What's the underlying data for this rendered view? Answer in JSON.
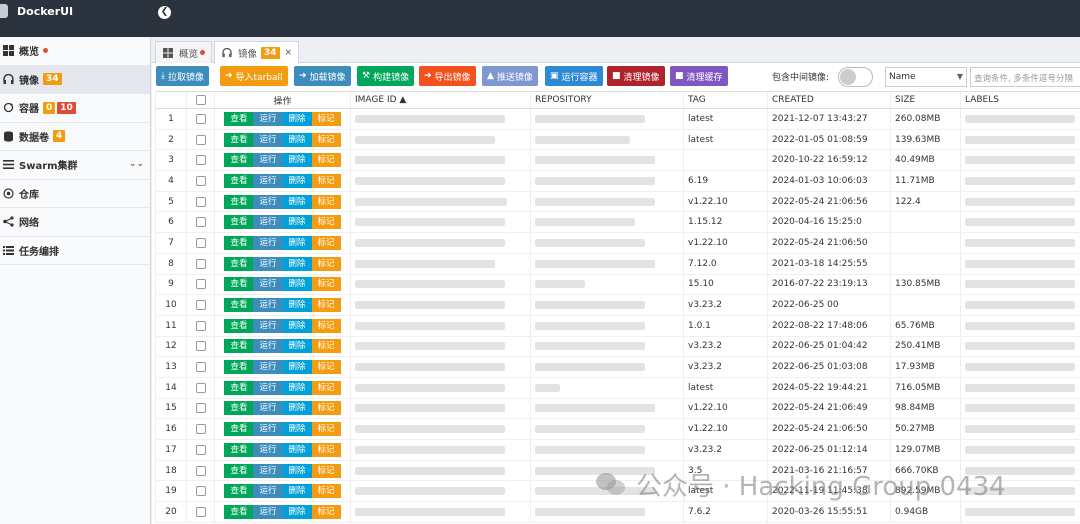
{
  "app": {
    "title": "DockerUI"
  },
  "sidebar": {
    "items": [
      {
        "label": "概览",
        "icon": "windows-icon",
        "dot": true
      },
      {
        "label": "镜像",
        "icon": "headset-icon",
        "badge": "34",
        "active": true
      },
      {
        "label": "容器",
        "icon": "refresh-icon",
        "badges": [
          "0",
          "10"
        ]
      },
      {
        "label": "数据卷",
        "icon": "database-icon",
        "badge": "4"
      },
      {
        "label": "Swarm集群",
        "icon": "swarm-icon",
        "chevron": true
      },
      {
        "label": "仓库",
        "icon": "radar-icon"
      },
      {
        "label": "网络",
        "icon": "network-icon"
      },
      {
        "label": "任务编排",
        "icon": "tasks-icon"
      }
    ]
  },
  "tabs": [
    {
      "label": "概览",
      "dot": true
    },
    {
      "label": "镜像",
      "badge": "34",
      "close": "×",
      "active": true
    }
  ],
  "toolbar": {
    "buttons": [
      {
        "label": "拉取镜像",
        "icon": "download-icon",
        "color": "#3c8dbc"
      },
      {
        "label": "导入tarball",
        "icon": "import-icon",
        "color": "#f39c12"
      },
      {
        "label": "加载镜像",
        "icon": "load-icon",
        "color": "#3c8dbc"
      },
      {
        "label": "构建镜像",
        "icon": "build-icon",
        "color": "#00a65a"
      },
      {
        "label": "导出镜像",
        "icon": "export-icon",
        "color": "#f4511e"
      },
      {
        "label": "推送镜像",
        "icon": "upload-icon",
        "color": "#7d97d0"
      },
      {
        "label": "运行容器",
        "icon": "run-icon",
        "color": "#2f8ad6"
      },
      {
        "label": "清理镜像",
        "icon": "trash-icon",
        "color": "#b0232d"
      },
      {
        "label": "清理缓存",
        "icon": "trash-icon",
        "color": "#7e57c2"
      }
    ],
    "include_intermediate_label": "包含中间镜像:",
    "filter_select": {
      "value": "Name"
    },
    "search": {
      "placeholder": "查询条件, 多条件逗号分隔"
    }
  },
  "table": {
    "headers": {
      "ops": "操作",
      "image_id": "IMAGE ID ▲",
      "repository": "REPOSITORY",
      "tag": "TAG",
      "created": "CREATED",
      "size": "SIZE",
      "labels": "LABELS"
    },
    "op_labels": {
      "view": "查看",
      "run": "运行",
      "delete": "删除",
      "mark": "标记"
    },
    "rows": [
      {
        "idx": "1",
        "tag": "latest",
        "created": "2021-12-07 13:43:27",
        "size": "260.08MB"
      },
      {
        "idx": "2",
        "tag": "latest",
        "created": "2022-01-05 01:08:59",
        "size": "139.63MB"
      },
      {
        "idx": "3",
        "tag": "",
        "created": "2020-10-22 16:59:12",
        "size": "40.49MB"
      },
      {
        "idx": "4",
        "tag": "6.19",
        "created": "2024-01-03 10:06:03",
        "size": "11.71MB"
      },
      {
        "idx": "5",
        "tag": "v1.22.10",
        "created": "2022-05-24 21:06:56",
        "size": "122.4"
      },
      {
        "idx": "6",
        "tag": "1.15.12",
        "created": "2020-04-16 15:25:0",
        "size": ""
      },
      {
        "idx": "7",
        "tag": "v1.22.10",
        "created": "2022-05-24 21:06:50",
        "size": ""
      },
      {
        "idx": "8",
        "tag": "7.12.0",
        "created": "2021-03-18 14:25:55",
        "size": ""
      },
      {
        "idx": "9",
        "tag": "15.10",
        "created": "2016-07-22 23:19:13",
        "size": "130.85MB"
      },
      {
        "idx": "10",
        "tag": "v3.23.2",
        "created": "2022-06-25 00",
        "size": ""
      },
      {
        "idx": "11",
        "tag": "1.0.1",
        "created": "2022-08-22 17:48:06",
        "size": "65.76MB"
      },
      {
        "idx": "12",
        "tag": "v3.23.2",
        "created": "2022-06-25 01:04:42",
        "size": "250.41MB"
      },
      {
        "idx": "13",
        "tag": "v3.23.2",
        "created": "2022-06-25 01:03:08",
        "size": "17.93MB"
      },
      {
        "idx": "14",
        "tag": "latest",
        "created": "2024-05-22 19:44:21",
        "size": "716.05MB"
      },
      {
        "idx": "15",
        "tag": "v1.22.10",
        "created": "2022-05-24 21:06:49",
        "size": "98.84MB"
      },
      {
        "idx": "16",
        "tag": "v1.22.10",
        "created": "2022-05-24 21:06:50",
        "size": "50.27MB"
      },
      {
        "idx": "17",
        "tag": "v3.23.2",
        "created": "2022-06-25 01:12:14",
        "size": "129.07MB"
      },
      {
        "idx": "18",
        "tag": "3.5",
        "created": "2021-03-16 21:16:57",
        "size": "666.70KB"
      },
      {
        "idx": "19",
        "tag": "latest",
        "created": "2022-11-19 11:45:38",
        "size": "892.59MB"
      },
      {
        "idx": "20",
        "tag": "7.6.2",
        "created": "2020-03-26 15:55:51",
        "size": "0.94GB"
      }
    ]
  },
  "watermark": {
    "text": "公众号 · Hacking Group 0434"
  }
}
